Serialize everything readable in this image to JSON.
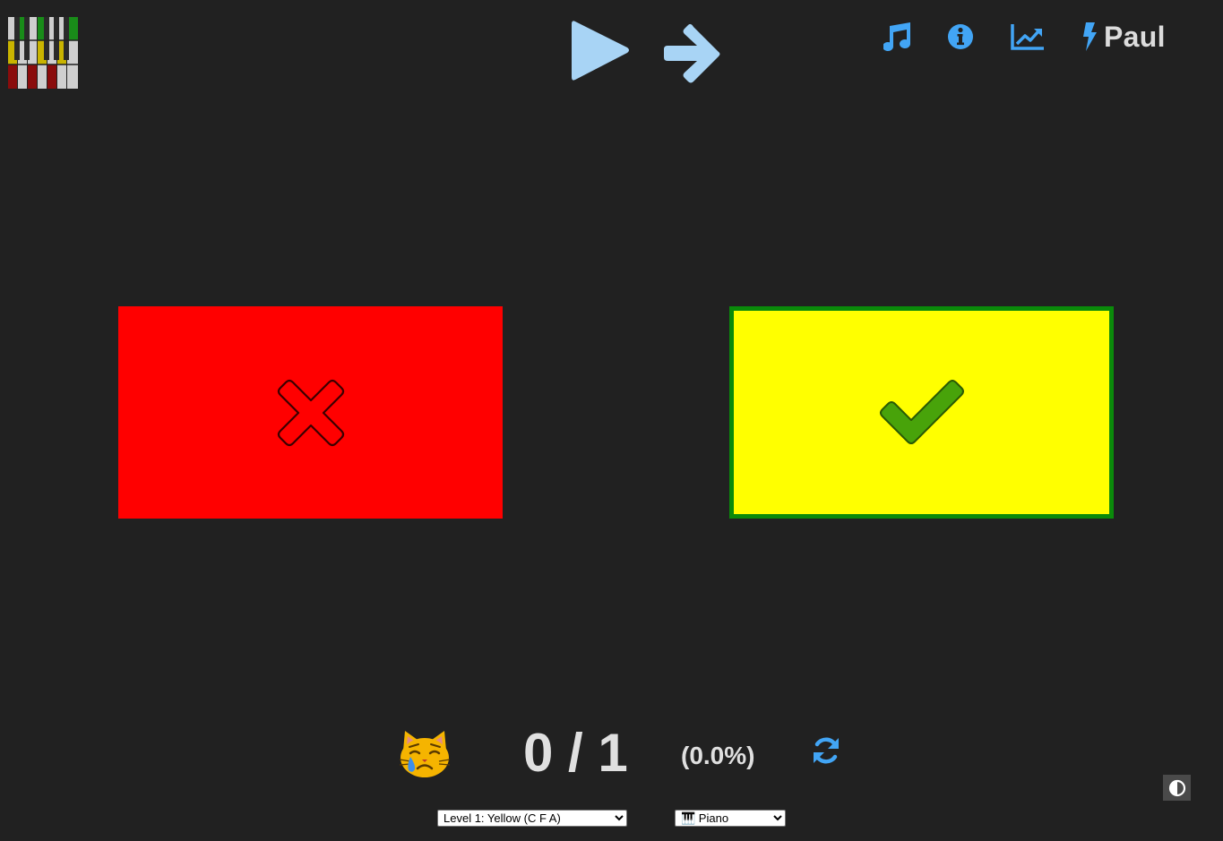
{
  "app": {
    "logo_icon": "piano-keys-logo-icon",
    "colors": {
      "background": "#212121",
      "accent": "#42a5f5",
      "control_light_blue": "#a8d4f5",
      "text": "#e0e0e0"
    }
  },
  "toolbar": {
    "play_icon": "play-icon",
    "next_icon": "arrow-right-icon"
  },
  "nav": {
    "music_icon": "music-note-icon",
    "info_icon": "info-circle-icon",
    "stats_icon": "line-chart-icon",
    "user_icon": "bolt-icon",
    "user_name": "Paul"
  },
  "answers": [
    {
      "icon": "x-cross-icon",
      "background": "#ff0000",
      "result": "wrong"
    },
    {
      "icon": "checkmark-icon",
      "background": "#ffff00",
      "border": "#0a8a0a",
      "result": "correct"
    }
  ],
  "score": {
    "mood_icon": "crying-cat-face-icon",
    "correct": "0",
    "total": "1",
    "text": "0 / 1",
    "percent": "(0.0%)",
    "reset_icon": "refresh-icon"
  },
  "contrast_icon": "contrast-half-circle-icon",
  "level_select": {
    "selected": "Level 1: Yellow (C F A)"
  },
  "instrument_select": {
    "selected": "🎹 Piano"
  }
}
